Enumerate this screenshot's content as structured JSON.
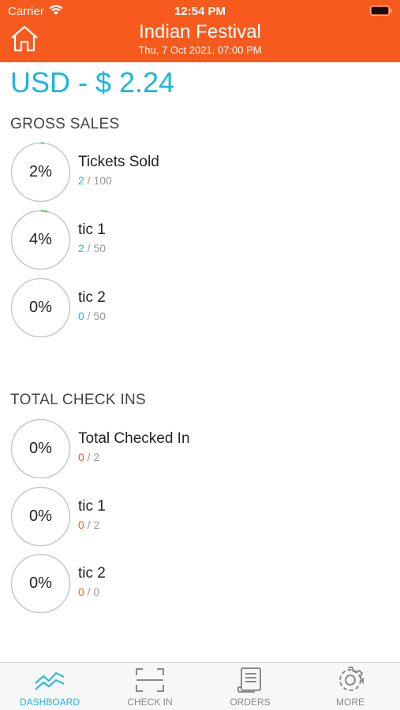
{
  "status_bar": {
    "carrier": "Carrier",
    "time": "12:54 PM"
  },
  "header": {
    "title": "Indian Festival",
    "subtitle": "Thu, 7 Oct 2021, 07:00 PM"
  },
  "amount": "USD - $ 2.24",
  "gross_sales": {
    "title": "GROSS SALES",
    "items": [
      {
        "percent": "2%",
        "label": "Tickets Sold",
        "current": "2",
        "total": "100",
        "fraction": 0.02
      },
      {
        "percent": "4%",
        "label": "tic 1",
        "current": "2",
        "total": "50",
        "fraction": 0.04
      },
      {
        "percent": "0%",
        "label": "tic 2",
        "current": "0",
        "total": "50",
        "fraction": 0
      }
    ]
  },
  "check_ins": {
    "title": "TOTAL CHECK INS",
    "items": [
      {
        "percent": "0%",
        "label": "Total Checked In",
        "current": "0",
        "total": "2",
        "fraction": 0
      },
      {
        "percent": "0%",
        "label": "tic 1",
        "current": "0",
        "total": "2",
        "fraction": 0
      },
      {
        "percent": "0%",
        "label": "tic 2",
        "current": "0",
        "total": "0",
        "fraction": 0
      }
    ]
  },
  "tabs": [
    {
      "label": "DASHBOARD",
      "active": true
    },
    {
      "label": "CHECK IN"
    },
    {
      "label": "ORDERS"
    },
    {
      "label": "MORE"
    }
  ],
  "colors": {
    "brand_orange": "#f75a1d",
    "accent_blue": "#1ab7dc",
    "progress_green": "#4cd964"
  }
}
